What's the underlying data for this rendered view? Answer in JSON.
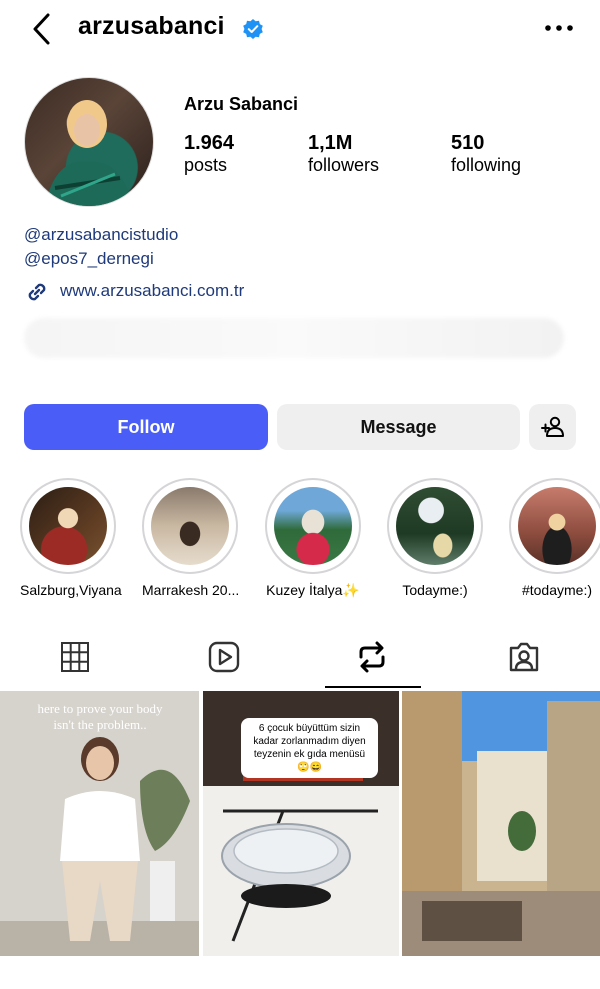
{
  "header": {
    "username": "arzusabanci",
    "verified": true,
    "back_icon": "chevron-left-icon",
    "more_icon": "more-horizontal-icon"
  },
  "profile": {
    "name": "Arzu Sabanci",
    "stats": [
      {
        "value": "1.964",
        "label": "posts"
      },
      {
        "value": "1,1M",
        "label": "followers"
      },
      {
        "value": "510",
        "label": "following"
      }
    ],
    "mentions": [
      "@arzusabancistudio",
      "@epos7_dernegi"
    ],
    "website": "www.arzusabanci.com.tr"
  },
  "actions": {
    "follow": "Follow",
    "message": "Message",
    "accent_color": "#4a5ef7"
  },
  "highlights": [
    {
      "label": "Salzburg,Viyana"
    },
    {
      "label": "Marrakesh 20..."
    },
    {
      "label": "Kuzey İtalya✨"
    },
    {
      "label": "Todayme:)"
    },
    {
      "label": "#todayme:)"
    }
  ],
  "tabs": [
    {
      "icon": "grid-icon"
    },
    {
      "icon": "reels-icon"
    },
    {
      "icon": "repost-icon",
      "active": true
    },
    {
      "icon": "tagged-icon"
    }
  ],
  "posts": [
    {
      "overlay": "here to prove your body isn't the problem.."
    },
    {
      "overlay": "6 çocuk büyüttüm sizin kadar zorlanmadım diyen teyzenin ek gıda menüsü 🙄😄"
    },
    {
      "overlay": ""
    }
  ]
}
